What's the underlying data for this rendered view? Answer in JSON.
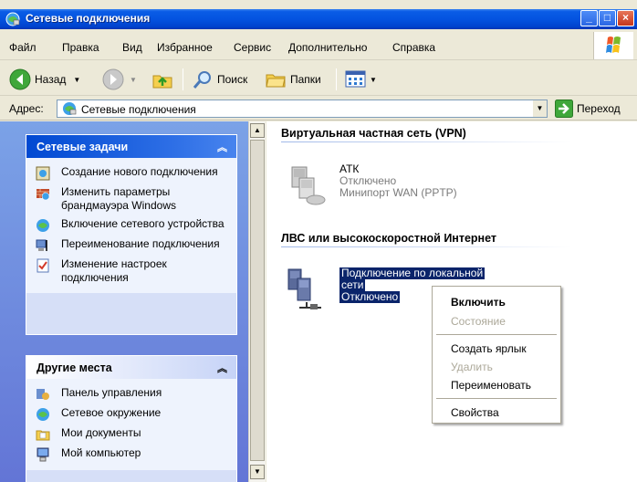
{
  "window": {
    "title": "Сетевые подключения",
    "controls": {
      "minimize": "_",
      "maximize": "□",
      "close": "×"
    }
  },
  "menubar": [
    "Файл",
    "Правка",
    "Вид",
    "Избранное",
    "Сервис",
    "Дополнительно",
    "Справка"
  ],
  "toolbar": {
    "back_label": "Назад",
    "search_label": "Поиск",
    "folders_label": "Папки"
  },
  "address": {
    "label": "Адрес:",
    "value": "Сетевые подключения",
    "go_label": "Переход"
  },
  "left": {
    "network_tasks": {
      "title": "Сетевые задачи",
      "items": [
        "Создание нового подключения",
        "Изменить параметры брандмауэра Windows",
        "Включение сетевого устройства",
        "Переименование подключения",
        "Изменение настроек подключения"
      ]
    },
    "other_places": {
      "title": "Другие места",
      "items": [
        "Панель управления",
        "Сетевое окружение",
        "Мои документы",
        "Мой компьютер"
      ]
    }
  },
  "content": {
    "vpn_group": {
      "title": "Виртуальная частная сеть (VPN)",
      "item": {
        "name": "АТК",
        "status": "Отключено",
        "device": "Минипорт WAN (PPTP)"
      }
    },
    "lan_group": {
      "title": "ЛВС или высокоскоростной Интернет",
      "item": {
        "name_line1": "Подключение по локальной",
        "name_line2": "сети",
        "status": "Отключено"
      }
    }
  },
  "context_menu": {
    "items": [
      {
        "label": "Включить",
        "state": "default"
      },
      {
        "label": "Состояние",
        "state": "disabled"
      },
      {
        "label": "Создать ярлык",
        "state": "normal"
      },
      {
        "label": "Удалить",
        "state": "disabled"
      },
      {
        "label": "Переименовать",
        "state": "normal"
      },
      {
        "label": "Свойства",
        "state": "normal"
      }
    ]
  },
  "colors": {
    "title_bar": "#0453E0",
    "task_pane_bg": "#7BA2E7",
    "selection": "#0A246A"
  }
}
